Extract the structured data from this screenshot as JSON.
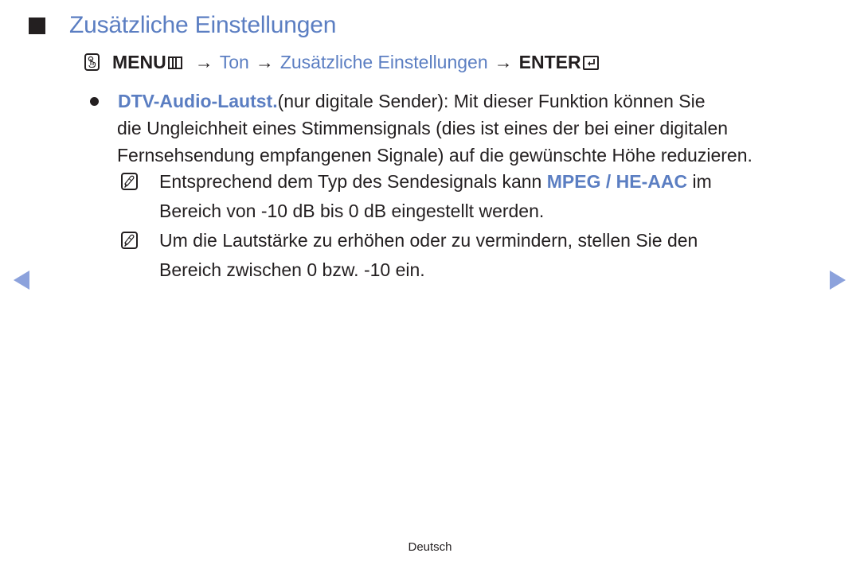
{
  "title": "Zusätzliche Einstellungen",
  "path": {
    "remote_icon": "remote-touch-icon",
    "menu_label": "MENU",
    "menu_icon": "menu-grid-icon",
    "arrow": "→",
    "steps": [
      "Ton",
      "Zusätzliche Einstellungen"
    ],
    "enter_label": "ENTER",
    "enter_icon": "enter-return-icon"
  },
  "bullet": {
    "term": "DTV-Audio-Lautst.",
    "line1_rest": "(nur digitale Sender): Mit dieser Funktion können Sie",
    "line2": "die Ungleichheit eines Stimmensignals (dies ist eines der bei einer digitalen",
    "line3": "Fernsehsendung empfangenen Signale) auf die gewünschte Höhe reduzieren."
  },
  "notes": [
    {
      "icon": "note-pencil-icon",
      "line1_before": "Entsprechend dem Typ des Sendesignals kann ",
      "line1_highlight": "MPEG / HE-AAC",
      "line1_after": " im",
      "line2": "Bereich von -10 dB bis 0 dB eingestellt werden."
    },
    {
      "icon": "note-pencil-icon",
      "line1": "Um die Lautstärke zu erhöhen oder zu vermindern, stellen Sie den",
      "line2": "Bereich zwischen 0 bzw. -10 ein."
    }
  ],
  "navigation": {
    "prev_icon": "triangle-left-icon",
    "next_icon": "triangle-right-icon"
  },
  "footer": {
    "language": "Deutsch"
  },
  "colors": {
    "accent": "#5b7ec2",
    "nav_arrow": "#8ca2dc",
    "text": "#231f20"
  }
}
